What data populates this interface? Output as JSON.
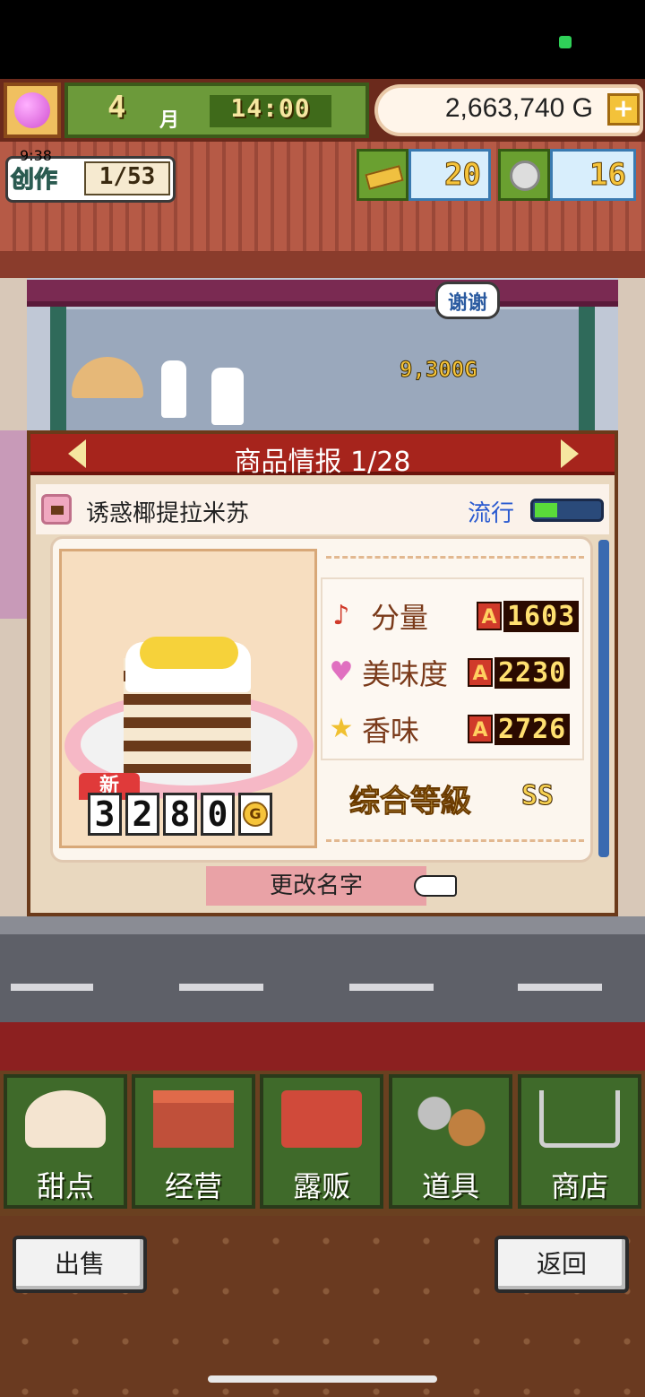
{
  "hud": {
    "month_number": "4",
    "month_label": "月",
    "time": "14:00",
    "money": "2,663,740 G",
    "add_label": "+"
  },
  "creation": {
    "timer": "9:38",
    "label": "创作",
    "progress": "1/53"
  },
  "resources": {
    "gold_bars": "20",
    "medals": "16"
  },
  "scene": {
    "speech_bubble": "谢谢",
    "floating_price": "9,300G"
  },
  "panel": {
    "title": "商品情报 1/28",
    "item_name": "诱惑椰提拉米苏",
    "trend_label": "流行",
    "trend_level": 0.35,
    "new_tag": "新",
    "price_digits": [
      "3",
      "2",
      "8",
      "0"
    ],
    "price_unit": "G",
    "stats": [
      {
        "icon": "music-note-icon",
        "glyph": "♪",
        "label": "分量",
        "rank": "A",
        "value": "1603",
        "icon_color": "#d03a2a"
      },
      {
        "icon": "heart-icon",
        "glyph": "♥",
        "label": "美味度",
        "rank": "A",
        "value": "2230",
        "icon_color": "#e070c0"
      },
      {
        "icon": "star-icon",
        "glyph": "★",
        "label": "香味",
        "rank": "A",
        "value": "2726",
        "icon_color": "#f0c030"
      }
    ],
    "grade_label": "综合等級",
    "grade_value": "SS",
    "rename_label": "更改名字"
  },
  "nav": [
    {
      "key": "sweets",
      "label": "甜点",
      "icon": "cake-icon"
    },
    {
      "key": "manage",
      "label": "经营",
      "icon": "shop-icon"
    },
    {
      "key": "stall",
      "label": "露贩",
      "icon": "food-truck-icon"
    },
    {
      "key": "items",
      "label": "道具",
      "icon": "gear-bag-icon"
    },
    {
      "key": "store",
      "label": "商店",
      "icon": "cart-icon"
    }
  ],
  "footer": {
    "sell_label": "出售",
    "back_label": "返回"
  },
  "colors": {
    "title_bar": "#a6241c",
    "nav_green": "#3f6a2a",
    "trend_fill": "#5ada3a"
  }
}
